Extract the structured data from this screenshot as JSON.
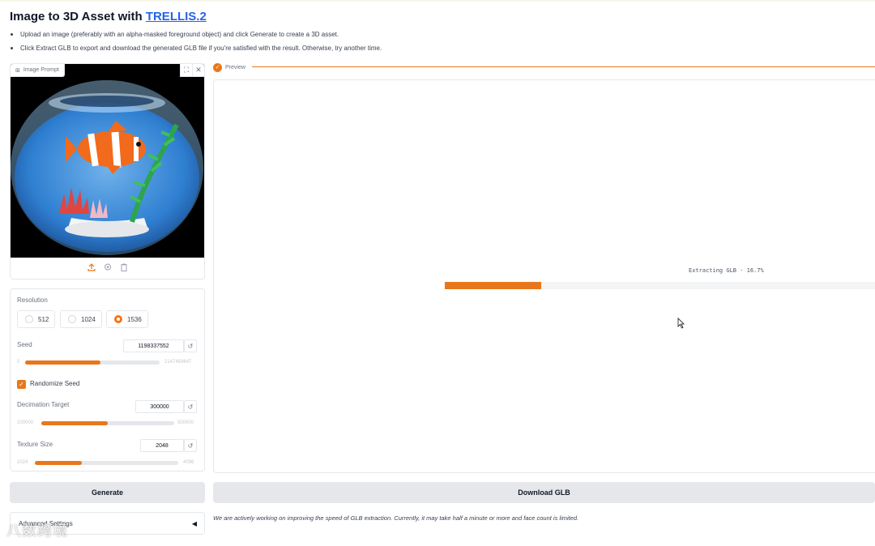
{
  "header": {
    "title_prefix": "Image to 3D Asset with ",
    "title_link": "TRELLIS.2",
    "bullets": [
      "Upload an image (preferably with an alpha-masked foreground object) and click Generate to create a 3D asset.",
      "Click Extract GLB to export and download the generated GLB file if you're satisfied with the result. Otherwise, try another time."
    ]
  },
  "image_prompt": {
    "label": "Image Prompt",
    "tool_icons": [
      "fullscreen-icon",
      "close-icon"
    ],
    "action_icons": [
      "upload-icon",
      "webcam-icon",
      "clipboard-icon"
    ]
  },
  "settings": {
    "resolution": {
      "label": "Resolution",
      "options": [
        "512",
        "1024",
        "1536"
      ],
      "selected": "1536"
    },
    "seed": {
      "label": "Seed",
      "value": "1198337552",
      "min": "0",
      "max": "2147483647",
      "fraction": 0.56
    },
    "randomize": {
      "label": "Randomize Seed",
      "checked": true
    },
    "decimation": {
      "label": "Decimation Target",
      "value": "300000",
      "min": "100000",
      "max": "500000",
      "fraction": 0.5
    },
    "texture": {
      "label": "Texture Size",
      "value": "2048",
      "min": "1024",
      "max": "4096",
      "fraction": 0.33
    }
  },
  "buttons": {
    "generate": "Generate",
    "download": "Download GLB"
  },
  "advanced": {
    "label": "Advanced Settings"
  },
  "preview": {
    "label": "Preview",
    "progress_text": "Extracting GLB - 16.7%",
    "progress_fraction": 0.167
  },
  "note": "We are actively working on improving the speed of GLB extraction. Currently, it may take half a minute or more and face count is limited.",
  "watermark": "八数跨境",
  "colors": {
    "accent": "#e8771c",
    "link": "#2563eb"
  }
}
